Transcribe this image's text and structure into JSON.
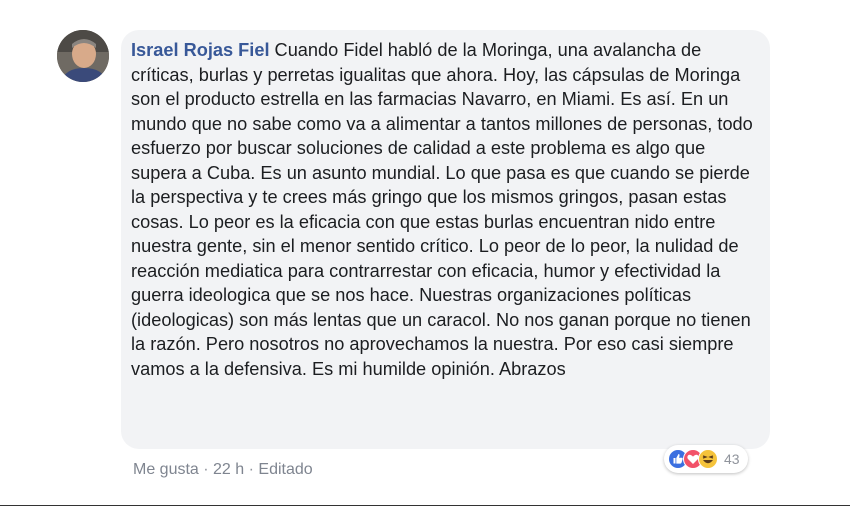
{
  "comment": {
    "author": "Israel Rojas Fiel",
    "text": " Cuando Fidel habló de la Moringa, una avalancha de críticas, burlas y perretas igualitas que ahora. Hoy, las cápsulas de Moringa son el producto estrella en las farmacias Navarro, en Miami. Es así. En un mundo que no sabe como va a alimentar a tantos millones de personas, todo esfuerzo por buscar soluciones de calidad a este problema es algo que supera a Cuba. Es un asunto mundial. Lo que pasa es que cuando se pierde la perspectiva y te crees más gringo que los mismos gringos, pasan estas cosas. Lo peor es la eficacia con que estas burlas encuentran nido entre nuestra gente, sin el menor sentido crítico. Lo peor de lo peor, la nulidad de reacción mediatica para contrarrestar con eficacia, humor y efectividad la guerra ideologica que se nos hace. Nuestras organizaciones políticas (ideologicas) son más lentas que un caracol. No nos ganan porque no tienen la razón. Pero nosotros no aprovechamos la nuestra. Por eso casi siempre vamos a la defensiva. Es mi humilde opinión. Abrazos"
  },
  "actions": {
    "like": "Me gusta",
    "sep1": " · ",
    "time": "22 h",
    "sep2": " · ",
    "edited": "Editado"
  },
  "reactions": {
    "count": "43",
    "icons": [
      "like-icon",
      "love-icon",
      "haha-icon"
    ],
    "colors": {
      "like": "#3b6fe0",
      "love": "#f25268",
      "haha": "#f5c33b"
    }
  }
}
